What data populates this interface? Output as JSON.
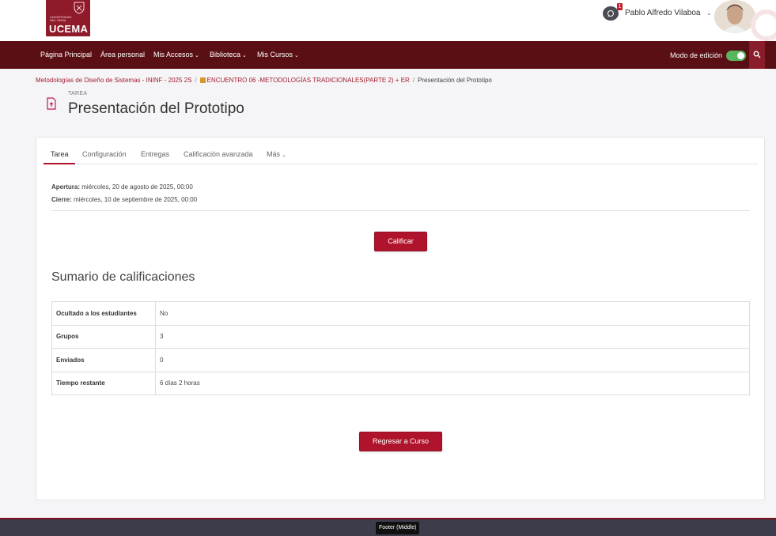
{
  "brand": {
    "logo_small_text": "UNIVERSIDAD DEL CEMA",
    "logo_name": "UCEMA",
    "accent_color": "#b0142c",
    "nav_color": "#5a0f14"
  },
  "user": {
    "name": "Pablo Alfredo Vilaboa",
    "notifications_count": "1"
  },
  "nav": {
    "items": [
      {
        "label": "Página Principal",
        "dropdown": false
      },
      {
        "label": "Área personal",
        "dropdown": false
      },
      {
        "label": "Mis Accesos",
        "dropdown": true
      },
      {
        "label": "Biblioteca",
        "dropdown": true
      },
      {
        "label": "Mis Cursos",
        "dropdown": true
      }
    ],
    "edit_mode_label": "Modo de edición",
    "edit_mode_on": true
  },
  "breadcrumb": {
    "course": "Metodologías de Diseño de Sistemas - ININF - 2025 2S",
    "section": "ENCUENTRO 06 -METODOLOGÍAS TRADICIONALES(PARTE 2) + ER",
    "current": "Presentación del Prototipo"
  },
  "page": {
    "kicker": "TAREA",
    "title": "Presentación del Prototipo"
  },
  "tabs": [
    {
      "label": "Tarea",
      "active": true
    },
    {
      "label": "Configuración",
      "active": false
    },
    {
      "label": "Entregas",
      "active": false
    },
    {
      "label": "Calificación avanzada",
      "active": false
    },
    {
      "label": "Más",
      "active": false
    }
  ],
  "dates": {
    "open_label": "Apertura:",
    "open_value": "miércoles, 20 de agosto de 2025, 00:00",
    "close_label": "Cierre:",
    "close_value": "miércoles, 10 de septiembre de 2025, 00:00"
  },
  "buttons": {
    "grade": "Calificar",
    "back": "Regresar a Curso"
  },
  "summary": {
    "title": "Sumario de calificaciones",
    "rows": [
      {
        "key": "Ocultado a los estudiantes",
        "value": "No"
      },
      {
        "key": "Grupos",
        "value": "3"
      },
      {
        "key": "Enviados",
        "value": "0"
      },
      {
        "key": "Tiempo restante",
        "value": "6 días 2 horas"
      }
    ]
  },
  "footer": {
    "tag": "Footer (Middle)"
  }
}
